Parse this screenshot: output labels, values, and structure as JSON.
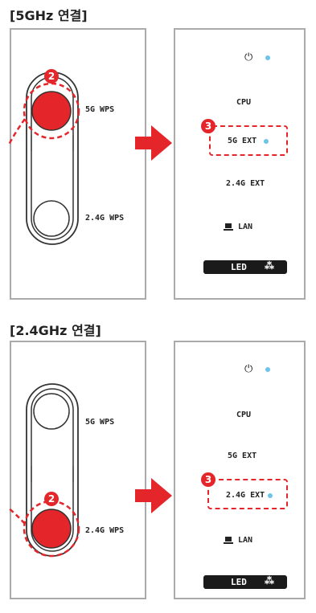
{
  "sections": [
    {
      "title": "[5GHz 연결]",
      "device": {
        "top_label": "5G WPS",
        "bottom_label": "2.4G WPS",
        "pressed": "top",
        "step": "2"
      },
      "status": {
        "power_symbol": "⏻",
        "rows": [
          "CPU",
          "5G EXT",
          "2.4G EXT",
          "LAN"
        ],
        "highlighted_row": "5G EXT",
        "step": "3",
        "led_button": "LED",
        "led_symbol": "⁂"
      }
    },
    {
      "title": "[2.4GHz 연결]",
      "device": {
        "top_label": "5G WPS",
        "bottom_label": "2.4G WPS",
        "pressed": "bottom",
        "step": "2"
      },
      "status": {
        "power_symbol": "⏻",
        "rows": [
          "CPU",
          "5G EXT",
          "2.4G EXT",
          "LAN"
        ],
        "highlighted_row": "2.4G EXT",
        "step": "3",
        "led_button": "LED",
        "led_symbol": "⁂"
      }
    }
  ],
  "colors": {
    "accent": "#e4262b",
    "led": "#6ec3ea",
    "panel_border": "#aaaaaa"
  }
}
